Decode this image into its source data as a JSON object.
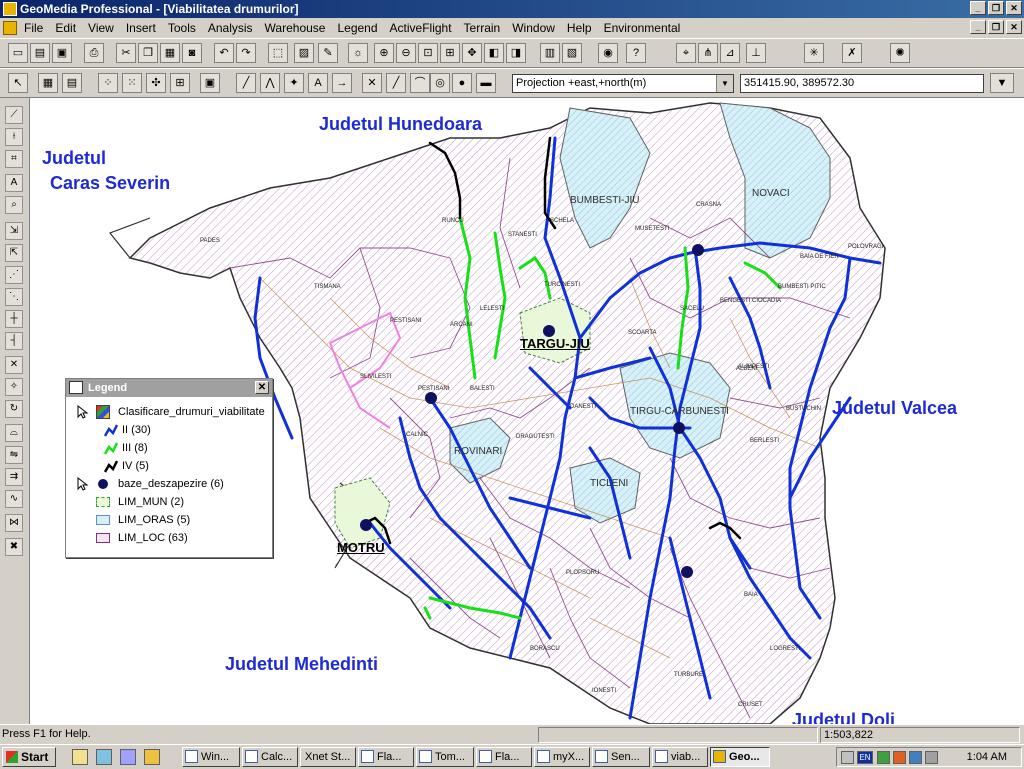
{
  "window": {
    "title": "GeoMedia Professional - [Viabilitatea drumurilor]",
    "min": "_",
    "restore": "❐",
    "close": "✕"
  },
  "menu": [
    "File",
    "Edit",
    "View",
    "Insert",
    "Tools",
    "Analysis",
    "Warehouse",
    "Legend",
    "ActiveFlight",
    "Terrain",
    "Window",
    "Help",
    "Environmental"
  ],
  "toolbar2": {
    "projection": "Projection +east,+north(m)",
    "coordinates": "351415.90, 389572.30"
  },
  "map": {
    "regions": {
      "hunedoara": "Judetul  Hunedoara",
      "caras": "Judetul",
      "caras2": "Caras Severin",
      "valcea": "Judetul  Valcea",
      "mehedinti": "Judetul  Mehedinti",
      "dolj": "Judetul Dolj"
    },
    "towns": {
      "targujiu": "TARGU-JIU",
      "motru": "MOTRU"
    },
    "orase": {
      "bumbesti": "BUMBESTI-JIU",
      "novaci": "NOVACI",
      "tirgucarb": "TIRGU-CARBUNESTI",
      "rovinari": "ROVINARI",
      "ticleni": "TICLENI"
    },
    "communes": [
      "PADES",
      "RUNCU",
      "SCHELA",
      "STANESTI",
      "CRASNA",
      "MUSETESTI",
      "BAIA DE FIER",
      "POLOVRAGI",
      "BUMBESTI PITIC",
      "TURCINESTI",
      "SCOARTA",
      "BENGESTI CIOCADIA",
      "ALIMPESTI",
      "PESTISANI",
      "ARCANI",
      "LELESTI",
      "TISMANA",
      "PADES",
      "SLIVILESTI",
      "BALESTI",
      "PESTISANI",
      "SACELU",
      "DRAGUTESTI",
      "DANESTI",
      "ALBENI",
      "BUSTUCHIN",
      "BERLESTI",
      "CALNIC",
      "PLOPSORU",
      "BAIA",
      "LOGRESTI",
      "CRUSET",
      "IONESTI",
      "BORASCU",
      "TURBURE"
    ]
  },
  "legend": {
    "title": "Legend",
    "items": {
      "clasificare": "Clasificare_drumuri_viabilitate",
      "ii": "II  (30)",
      "iii": "III  (8)",
      "iv": "IV  (5)",
      "baze": "baze_deszapezire  (6)",
      "mun": "LIM_MUN  (2)",
      "oras": "LIM_ORAS  (5)",
      "loc": "LIM_LOC  (63)"
    },
    "colors": {
      "ii": "#1030d8",
      "iii": "#18e018",
      "iv": "#000000",
      "baze": "#101060"
    }
  },
  "status": {
    "help": "Press F1 for Help.",
    "scale": "1:503,822"
  },
  "taskbar": {
    "start": "Start",
    "tasks": [
      "Win...",
      "Calc...",
      "Xnet St...",
      "Fla...",
      "Tom...",
      "Fla...",
      "myX...",
      "Sen...",
      "viab...",
      "Geo..."
    ],
    "lang": "EN",
    "clock": "1:04 AM"
  }
}
